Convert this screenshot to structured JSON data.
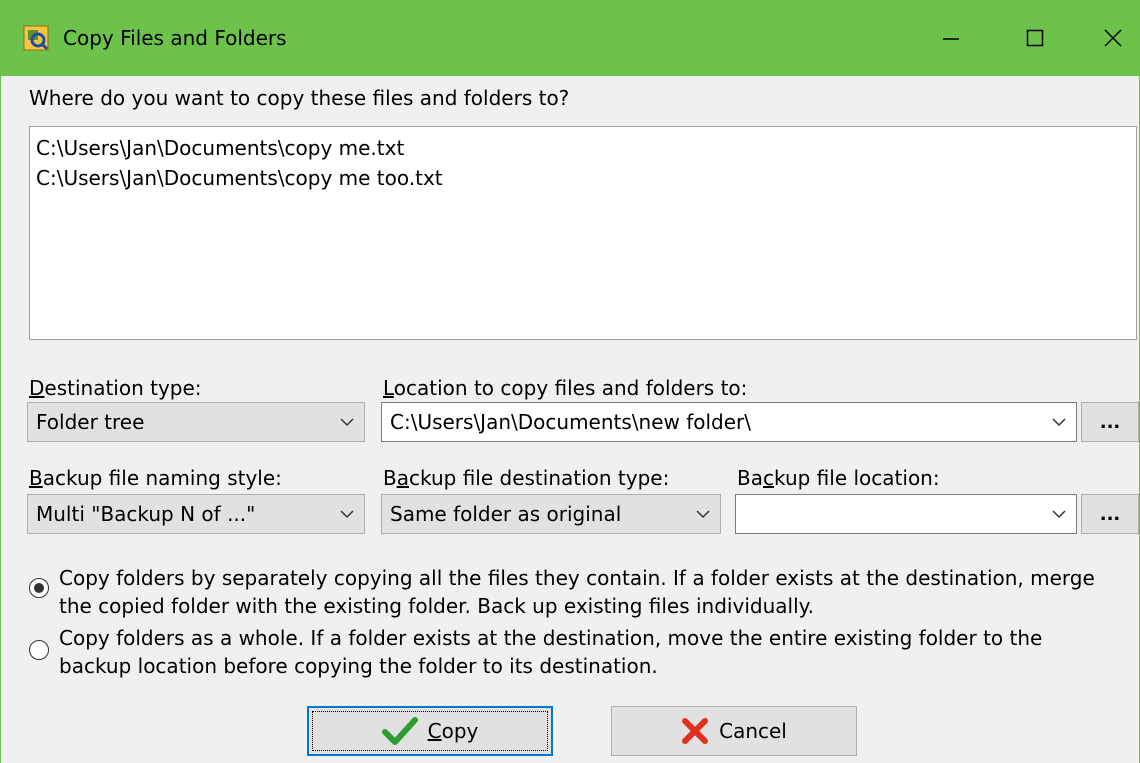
{
  "window": {
    "title": "Copy Files and Folders",
    "accent_color": "#6cc24a",
    "controls": [
      "minimize-icon",
      "maximize-icon",
      "close-icon"
    ]
  },
  "prompt": "Where do you want to copy these files and folders to?",
  "files": [
    "C:\\Users\\Jan\\Documents\\copy me.txt",
    "C:\\Users\\Jan\\Documents\\copy me too.txt"
  ],
  "destination_type": {
    "label_pre": "",
    "label_key": "D",
    "label_post": "estination type:",
    "value": "Folder tree"
  },
  "location": {
    "label_pre": "",
    "label_key": "L",
    "label_post": "ocation to copy files and folders to:",
    "value": "C:\\Users\\Jan\\Documents\\new folder\\",
    "browse_label": "..."
  },
  "backup_naming": {
    "label_pre": "",
    "label_key": "B",
    "label_post": "ackup file naming style:",
    "value": "Multi \"Backup N of ...\""
  },
  "backup_dest_type": {
    "label_pre": "B",
    "label_key": "a",
    "label_post": "ckup file destination type:",
    "value": "Same folder as original"
  },
  "backup_location": {
    "label_pre": "Ba",
    "label_key": "c",
    "label_post": "kup file location:",
    "value": "",
    "browse_label": "..."
  },
  "options": [
    {
      "line1": "Copy folders by separately copying all the files they contain.  If a folder exists at the destination, merge",
      "line2": "the copied folder with the existing folder.  Back up existing files individually.",
      "selected": true
    },
    {
      "line1": "Copy folders as a whole.  If a folder exists at the destination, move the entire existing folder to the",
      "line2": "backup location before copying the folder to its destination.",
      "selected": false
    }
  ],
  "buttons": {
    "copy_key": "C",
    "copy_rest": "opy",
    "cancel": "Cancel"
  }
}
